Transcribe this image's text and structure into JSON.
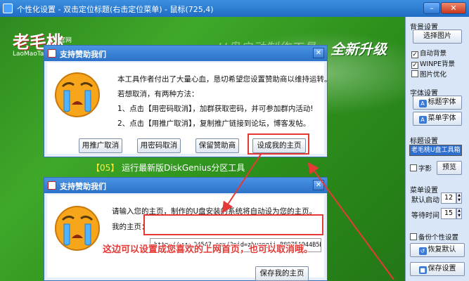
{
  "window": {
    "title": "个性化设置 - 双击定位标题(右击定位菜单) - 鼠标(725,4)",
    "min_label": "–",
    "close_label": "✕"
  },
  "background": {
    "logo": "老毛桃",
    "logo_sub": "官网",
    "logo_en": "LaoMaoTao",
    "headline_faded": "U盘启动制作工具",
    "headline": "全新升级",
    "menu_item_number": "【05】",
    "menu_item_text": " 运行最新版DiskGenius分区工具"
  },
  "dialog1": {
    "title": "支持赞助我们",
    "close": "✕",
    "line1": "本工具作者付出了大量心血，恳切希望您设置赞助商以维持运转。",
    "line2": "若想取消，有两种方法：",
    "line3_prefix": "1、点击",
    "line3_hl": "【用密码取消】",
    "line3_suffix": "，加群获取密码，并可参加群内活动!",
    "line4_prefix": "2、点击",
    "line4_hl": "【用推广取消】",
    "line4_suffix": "，复制推广链接到论坛，博客发帖。",
    "buttons": [
      "用推广取消",
      "用密码取消",
      "保留赞助商",
      "设成我的主页"
    ]
  },
  "dialog2": {
    "title": "支持赞助我们",
    "close": "✕",
    "line1": "请输入您的主页，制作的U盘安装的系统将自动设为您的主页。",
    "homepage_label": "我的主页：",
    "homepage_value": "http://www.24547.com/?pid=zhuangji_B8975A944B5B",
    "annotation": "这边可以设置成您喜欢的上网首页，也可以取消哦。",
    "save_button": "保存我的主页"
  },
  "panel": {
    "bg_section": "背景设置",
    "select_image": "选择图片",
    "auto_bg": "自动背景",
    "winpe_bg": "WINPE背景",
    "image_optimize": "图片优化",
    "font_section": "字体设置",
    "title_font": "标题字体",
    "menu_font": "菜单字体",
    "title_section": "标题设置",
    "title_value": "老毛桃U盘工具箱",
    "shadow_font": "字影",
    "preview": "预览",
    "menu_section": "菜单设置",
    "default_start": "默认启动",
    "default_start_value": "12",
    "wait_time": "等待时间",
    "wait_time_value": "15",
    "backup_custom": "备份个性设置",
    "restore_default": "恢复默认",
    "save_settings": "保存设置"
  }
}
